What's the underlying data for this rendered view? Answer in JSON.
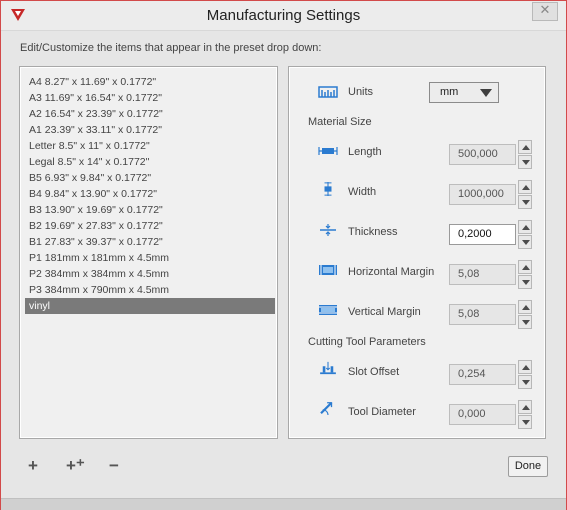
{
  "window": {
    "title": "Manufacturing Settings",
    "close_glyph": "✕",
    "accent_color": "#c62828"
  },
  "instructions": "Edit/Customize the items that appear in the preset drop down:",
  "presets": [
    "A4 8.27\" x 11.69\" x 0.1772\"",
    "A3 11.69\" x 16.54\" x 0.1772\"",
    "A2 16.54\" x 23.39\" x 0.1772\"",
    "A1 23.39\" x 33.11\" x 0.1772\"",
    "Letter 8.5\" x 11\" x 0.1772\"",
    "Legal 8.5\" x 14\" x 0.1772\"",
    "B5 6.93\" x 9.84\" x 0.1772\"",
    "B4 9.84\" x 13.90\" x 0.1772\"",
    "B3 13.90\" x 19.69\" x 0.1772\"",
    "B2 19.69\" x 27.83\" x 0.1772\"",
    "B1 27.83\" x 39.37\" x 0.1772\"",
    "P1 181mm x 181mm x 4.5mm",
    "P2 384mm x 384mm x 4.5mm",
    "P3 384mm x 790mm x 4.5mm",
    "vinyl"
  ],
  "selected_preset": "vinyl",
  "settings": {
    "units_label": "Units",
    "units_value": "mm",
    "material_size_header": "Material Size",
    "length_label": "Length",
    "length_value": "500,000",
    "width_label": "Width",
    "width_value": "1000,000",
    "thickness_label": "Thickness",
    "thickness_value": "0,2000",
    "horizontal_margin_label": "Horizontal Margin",
    "horizontal_margin_value": "5,08",
    "vertical_margin_label": "Vertical Margin",
    "vertical_margin_value": "5,08",
    "cutting_tool_header": "Cutting Tool Parameters",
    "slot_offset_label": "Slot Offset",
    "slot_offset_value": "0,254",
    "tool_diameter_label": "Tool Diameter",
    "tool_diameter_value": "0,000"
  },
  "toolbar": {
    "add_glyph": "+",
    "add_copy_glyph": "+⁺",
    "remove_glyph": "−"
  },
  "done_label": "Done",
  "icons": {
    "app": "app-logo-icon",
    "units": "ruler-icon",
    "length": "length-icon",
    "width": "width-icon",
    "thickness": "thickness-icon",
    "horizontal_margin": "horizontal-margin-icon",
    "vertical_margin": "vertical-margin-icon",
    "slot_offset": "slot-offset-icon",
    "tool_diameter": "tool-diameter-icon"
  },
  "icon_color": "#2b7bd0"
}
